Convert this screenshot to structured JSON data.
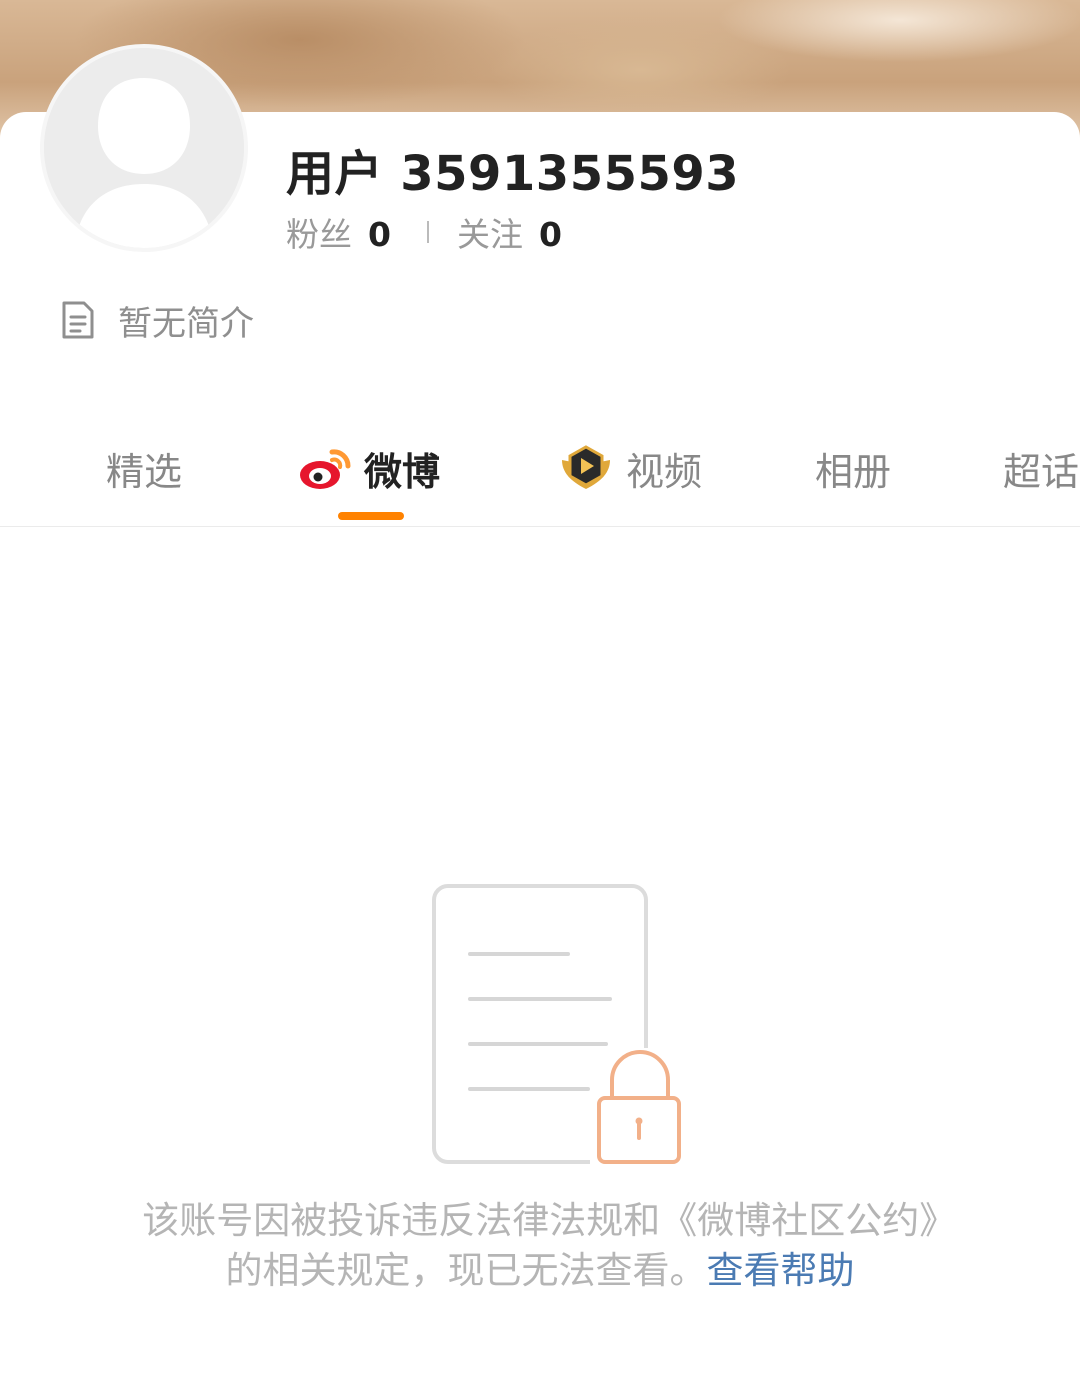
{
  "profile": {
    "username": "用户 3591355593",
    "fans_label": "粉丝",
    "fans_count": "0",
    "follow_label": "关注",
    "follow_count": "0",
    "bio": "暂无简介"
  },
  "tabs": [
    {
      "label": "精选",
      "active": false,
      "icon": ""
    },
    {
      "label": "微博",
      "active": true,
      "icon": "weibo-logo-icon"
    },
    {
      "label": "视频",
      "active": false,
      "icon": "video-badge-icon"
    },
    {
      "label": "相册",
      "active": false,
      "icon": ""
    },
    {
      "label": "超话",
      "active": false,
      "icon": ""
    }
  ],
  "notice": {
    "text": "该账号因被投诉违反法律法规和《微博社区公约》的相关规定，现已无法查看。",
    "link": "查看帮助"
  },
  "colors": {
    "accent": "#ff8200",
    "link": "#4b7bb3",
    "muted_text": "#b5b5b5"
  }
}
